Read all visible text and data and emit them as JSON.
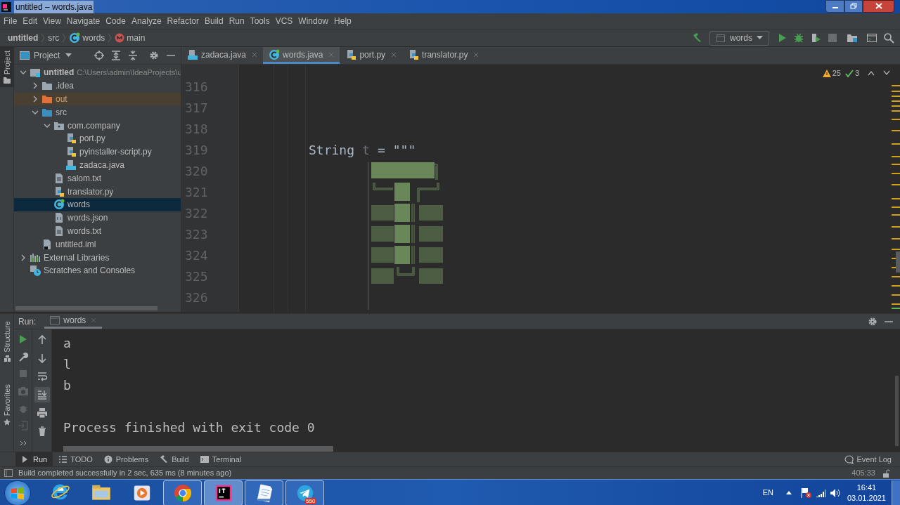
{
  "window": {
    "title": "untitled – words.java"
  },
  "menu": [
    "File",
    "Edit",
    "View",
    "Navigate",
    "Code",
    "Analyze",
    "Refactor",
    "Build",
    "Run",
    "Tools",
    "VCS",
    "Window",
    "Help"
  ],
  "breadcrumbs": [
    {
      "label": "untitled",
      "kind": "project"
    },
    {
      "label": "src",
      "kind": "plain"
    },
    {
      "label": "words",
      "kind": "class"
    },
    {
      "label": "main",
      "kind": "method"
    }
  ],
  "toolbar": [
    {
      "kind": "build",
      "disabled": false
    },
    {
      "kind": "config",
      "label": "words",
      "disabled": false
    },
    {
      "kind": "run",
      "disabled": false
    },
    {
      "kind": "debug",
      "disabled": false
    },
    {
      "kind": "coverage",
      "disabled": false
    },
    {
      "kind": "stop",
      "disabled": true
    },
    {
      "kind": "structure",
      "disabled": false
    },
    {
      "kind": "terminal",
      "disabled": false
    },
    {
      "kind": "search",
      "disabled": false
    }
  ],
  "side_tabs": [
    {
      "label": "Project",
      "selected": true
    },
    {
      "label": "Structure",
      "selected": false
    },
    {
      "label": "Favorites",
      "selected": false
    }
  ],
  "project_panel": {
    "title": "Project",
    "tree": [
      {
        "label": "untitled",
        "detail": "C:\\Users\\admin\\IdeaProjects\\u",
        "kind": "module",
        "expanded": true,
        "selected": false,
        "children": [
          {
            "label": ".idea",
            "kind": "folder",
            "expanded": false,
            "selected": false
          },
          {
            "label": "out",
            "kind": "excluded",
            "expanded": false,
            "selected": false
          },
          {
            "label": "src",
            "kind": "source",
            "expanded": true,
            "selected": false,
            "children": [
              {
                "label": "com.company",
                "kind": "package",
                "expanded": true,
                "selected": false,
                "children": [
                  {
                    "label": "port.py",
                    "kind": "python",
                    "selected": false
                  },
                  {
                    "label": "pyinstaller-script.py",
                    "kind": "python",
                    "selected": false
                  },
                  {
                    "label": "zadaca.java",
                    "kind": "java",
                    "selected": false
                  }
                ]
              },
              {
                "label": "salom.txt",
                "kind": "text",
                "selected": false
              },
              {
                "label": "translator.py",
                "kind": "python",
                "selected": false
              },
              {
                "label": "words",
                "kind": "class",
                "selected": true
              },
              {
                "label": "words.json",
                "kind": "json",
                "selected": false
              },
              {
                "label": "words.txt",
                "kind": "text",
                "selected": false
              }
            ]
          },
          {
            "label": "untitled.iml",
            "kind": "iml",
            "selected": false
          }
        ]
      },
      {
        "label": "External Libraries",
        "kind": "libraries",
        "expanded": false,
        "selected": false
      },
      {
        "label": "Scratches and Consoles",
        "kind": "scratches",
        "selected": false
      }
    ]
  },
  "editor_tabs": [
    {
      "label": "zadaca.java",
      "kind": "java",
      "selected": false
    },
    {
      "label": "words.java",
      "kind": "class",
      "selected": true
    },
    {
      "label": "port.py",
      "kind": "python",
      "selected": false
    },
    {
      "label": "translator.py",
      "kind": "python",
      "selected": false
    }
  ],
  "inspections": {
    "warnings": "25",
    "checks": "3"
  },
  "code_lines": [
    {
      "number": "316"
    },
    {
      "number": "317"
    },
    {
      "number": "318"
    },
    {
      "number": "319",
      "code": [
        {
          "text": "String",
          "kind": "plain"
        },
        {
          "text": "t",
          "kind": "unused"
        },
        {
          "text": "=",
          "kind": "plain"
        },
        {
          "text": "\"\"\"",
          "kind": "plain"
        }
      ]
    },
    {
      "number": "320",
      "art": true
    },
    {
      "number": "321"
    },
    {
      "number": "322"
    },
    {
      "number": "323"
    },
    {
      "number": "324"
    },
    {
      "number": "325"
    },
    {
      "number": "326"
    }
  ],
  "run_panel": {
    "label": "Run:",
    "tabs": [
      {
        "label": "words",
        "selected": true
      }
    ],
    "output": [
      "a",
      "l",
      "b"
    ],
    "exit_message": "Process finished with exit code 0",
    "actions": [
      {
        "kind": "rerun",
        "disabled": false
      },
      {
        "kind": "up",
        "disabled": false
      },
      {
        "kind": "wrench",
        "disabled": false
      },
      {
        "kind": "down",
        "disabled": false
      },
      {
        "kind": "stop",
        "disabled": true
      },
      {
        "kind": "wrap",
        "disabled": false
      },
      {
        "kind": "camera",
        "disabled": true
      },
      {
        "kind": "scroll",
        "disabled": false
      },
      {
        "kind": "bug",
        "disabled": true
      },
      {
        "kind": "print",
        "disabled": false
      },
      {
        "kind": "exit",
        "disabled": true
      },
      {
        "kind": "trash",
        "disabled": false
      },
      {
        "kind": "more",
        "disabled": false
      }
    ]
  },
  "tool_windows": [
    {
      "label": "Run",
      "kind": "run",
      "selected": true
    },
    {
      "label": "TODO",
      "kind": "list",
      "selected": false
    },
    {
      "label": "Problems",
      "kind": "info",
      "selected": false
    },
    {
      "label": "Build",
      "kind": "hammer",
      "selected": false
    },
    {
      "label": "Terminal",
      "kind": "terminal",
      "selected": false
    }
  ],
  "event_log": "Event Log",
  "status": {
    "message": "Build completed successfully in 2 sec, 635 ms (8 minutes ago)",
    "position": "405:33"
  },
  "taskbar": {
    "apps": [
      {
        "kind": "ie",
        "running": false,
        "selected": false
      },
      {
        "kind": "explorer",
        "running": false,
        "selected": false
      },
      {
        "kind": "media",
        "running": false,
        "selected": false
      },
      {
        "kind": "chrome",
        "running": true,
        "selected": false
      },
      {
        "kind": "intellij",
        "running": true,
        "selected": true
      },
      {
        "kind": "notepad",
        "running": true,
        "selected": false
      },
      {
        "kind": "telegram",
        "running": true,
        "selected": false,
        "badge": "550"
      }
    ],
    "tray": {
      "language": "EN",
      "time": "16:41",
      "date": "03.01.2021"
    }
  }
}
